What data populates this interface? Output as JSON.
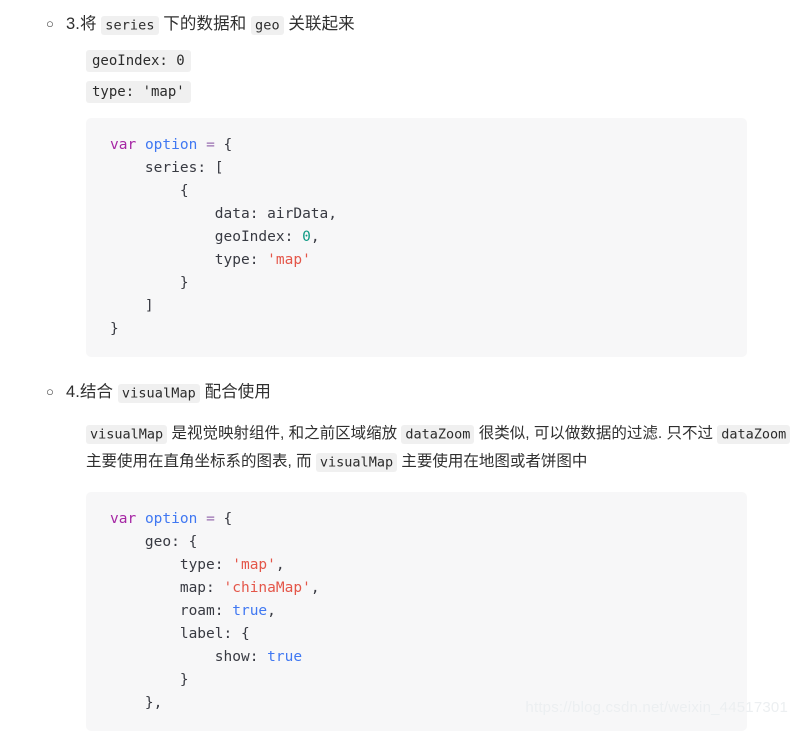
{
  "sections": [
    {
      "bullet": "○",
      "heading": {
        "parts": [
          {
            "type": "text",
            "text": "3.将 "
          },
          {
            "type": "code",
            "text": "series"
          },
          {
            "type": "text",
            "text": " 下的数据和 "
          },
          {
            "type": "code",
            "text": "geo"
          },
          {
            "type": "text",
            "text": " 关联起来"
          }
        ]
      },
      "chip_lines": [
        "geoIndex: 0",
        "type: 'map'"
      ],
      "code_block": {
        "language": "javascript",
        "lines": [
          [
            {
              "t": "kw",
              "v": "var"
            },
            {
              "t": "punc",
              "v": " "
            },
            {
              "t": "var",
              "v": "option"
            },
            {
              "t": "punc",
              "v": " "
            },
            {
              "t": "op",
              "v": "="
            },
            {
              "t": "punc",
              "v": " {"
            }
          ],
          [
            {
              "t": "punc",
              "v": "    "
            },
            {
              "t": "prop",
              "v": "series"
            },
            {
              "t": "punc",
              "v": ": ["
            }
          ],
          [
            {
              "t": "punc",
              "v": "        {"
            }
          ],
          [
            {
              "t": "punc",
              "v": "            "
            },
            {
              "t": "prop",
              "v": "data"
            },
            {
              "t": "punc",
              "v": ": "
            },
            {
              "t": "prop",
              "v": "airData"
            },
            {
              "t": "punc",
              "v": ","
            }
          ],
          [
            {
              "t": "punc",
              "v": "            "
            },
            {
              "t": "prop",
              "v": "geoIndex"
            },
            {
              "t": "punc",
              "v": ": "
            },
            {
              "t": "num",
              "v": "0"
            },
            {
              "t": "punc",
              "v": ","
            }
          ],
          [
            {
              "t": "punc",
              "v": "            "
            },
            {
              "t": "prop",
              "v": "type"
            },
            {
              "t": "punc",
              "v": ": "
            },
            {
              "t": "str",
              "v": "'map'"
            }
          ],
          [
            {
              "t": "punc",
              "v": "        }"
            }
          ],
          [
            {
              "t": "punc",
              "v": "    ]"
            }
          ],
          [
            {
              "t": "punc",
              "v": "}"
            }
          ]
        ]
      }
    },
    {
      "bullet": "○",
      "heading": {
        "parts": [
          {
            "type": "text",
            "text": "4.结合 "
          },
          {
            "type": "code",
            "text": "visualMap"
          },
          {
            "type": "text",
            "text": " 配合使用"
          }
        ]
      },
      "paragraph": {
        "parts": [
          {
            "type": "code",
            "text": "visualMap"
          },
          {
            "type": "text",
            "text": " 是视觉映射组件, 和之前区域缩放 "
          },
          {
            "type": "code",
            "text": "dataZoom"
          },
          {
            "type": "text",
            "text": " 很类似, 可以做数据的过滤. 只不过 "
          },
          {
            "type": "code",
            "text": "dataZoom"
          },
          {
            "type": "text",
            "text": " 主要使用在直角坐标系的图表, 而 "
          },
          {
            "type": "code",
            "text": "visualMap"
          },
          {
            "type": "text",
            "text": " 主要使用在地图或者饼图中"
          }
        ]
      },
      "code_block": {
        "language": "javascript",
        "lines": [
          [
            {
              "t": "kw",
              "v": "var"
            },
            {
              "t": "punc",
              "v": " "
            },
            {
              "t": "var",
              "v": "option"
            },
            {
              "t": "punc",
              "v": " "
            },
            {
              "t": "op",
              "v": "="
            },
            {
              "t": "punc",
              "v": " {"
            }
          ],
          [
            {
              "t": "punc",
              "v": "    "
            },
            {
              "t": "prop",
              "v": "geo"
            },
            {
              "t": "punc",
              "v": ": {"
            }
          ],
          [
            {
              "t": "punc",
              "v": "        "
            },
            {
              "t": "prop",
              "v": "type"
            },
            {
              "t": "punc",
              "v": ": "
            },
            {
              "t": "str",
              "v": "'map'"
            },
            {
              "t": "punc",
              "v": ","
            }
          ],
          [
            {
              "t": "punc",
              "v": "        "
            },
            {
              "t": "prop",
              "v": "map"
            },
            {
              "t": "punc",
              "v": ": "
            },
            {
              "t": "str",
              "v": "'chinaMap'"
            },
            {
              "t": "punc",
              "v": ","
            }
          ],
          [
            {
              "t": "punc",
              "v": "        "
            },
            {
              "t": "prop",
              "v": "roam"
            },
            {
              "t": "punc",
              "v": ": "
            },
            {
              "t": "bool",
              "v": "true"
            },
            {
              "t": "punc",
              "v": ","
            }
          ],
          [
            {
              "t": "punc",
              "v": "        "
            },
            {
              "t": "prop",
              "v": "label"
            },
            {
              "t": "punc",
              "v": ": {"
            }
          ],
          [
            {
              "t": "punc",
              "v": "            "
            },
            {
              "t": "prop",
              "v": "show"
            },
            {
              "t": "punc",
              "v": ": "
            },
            {
              "t": "bool",
              "v": "true"
            }
          ],
          [
            {
              "t": "punc",
              "v": "        }"
            }
          ],
          [
            {
              "t": "punc",
              "v": "    },"
            }
          ]
        ]
      }
    }
  ],
  "watermark": "https://blog.csdn.net/weixin_44517301",
  "colors": {
    "page_background": "#ffffff",
    "code_block_background": "#f7f7f8",
    "inline_code_background": "#f0f0f0",
    "keyword": "#a626a4",
    "variable": "#4078f2",
    "string": "#e45649",
    "number": "#0f9a84",
    "boolean": "#4078f2",
    "text": "#2f2f2f",
    "watermark": "#eceff1"
  }
}
